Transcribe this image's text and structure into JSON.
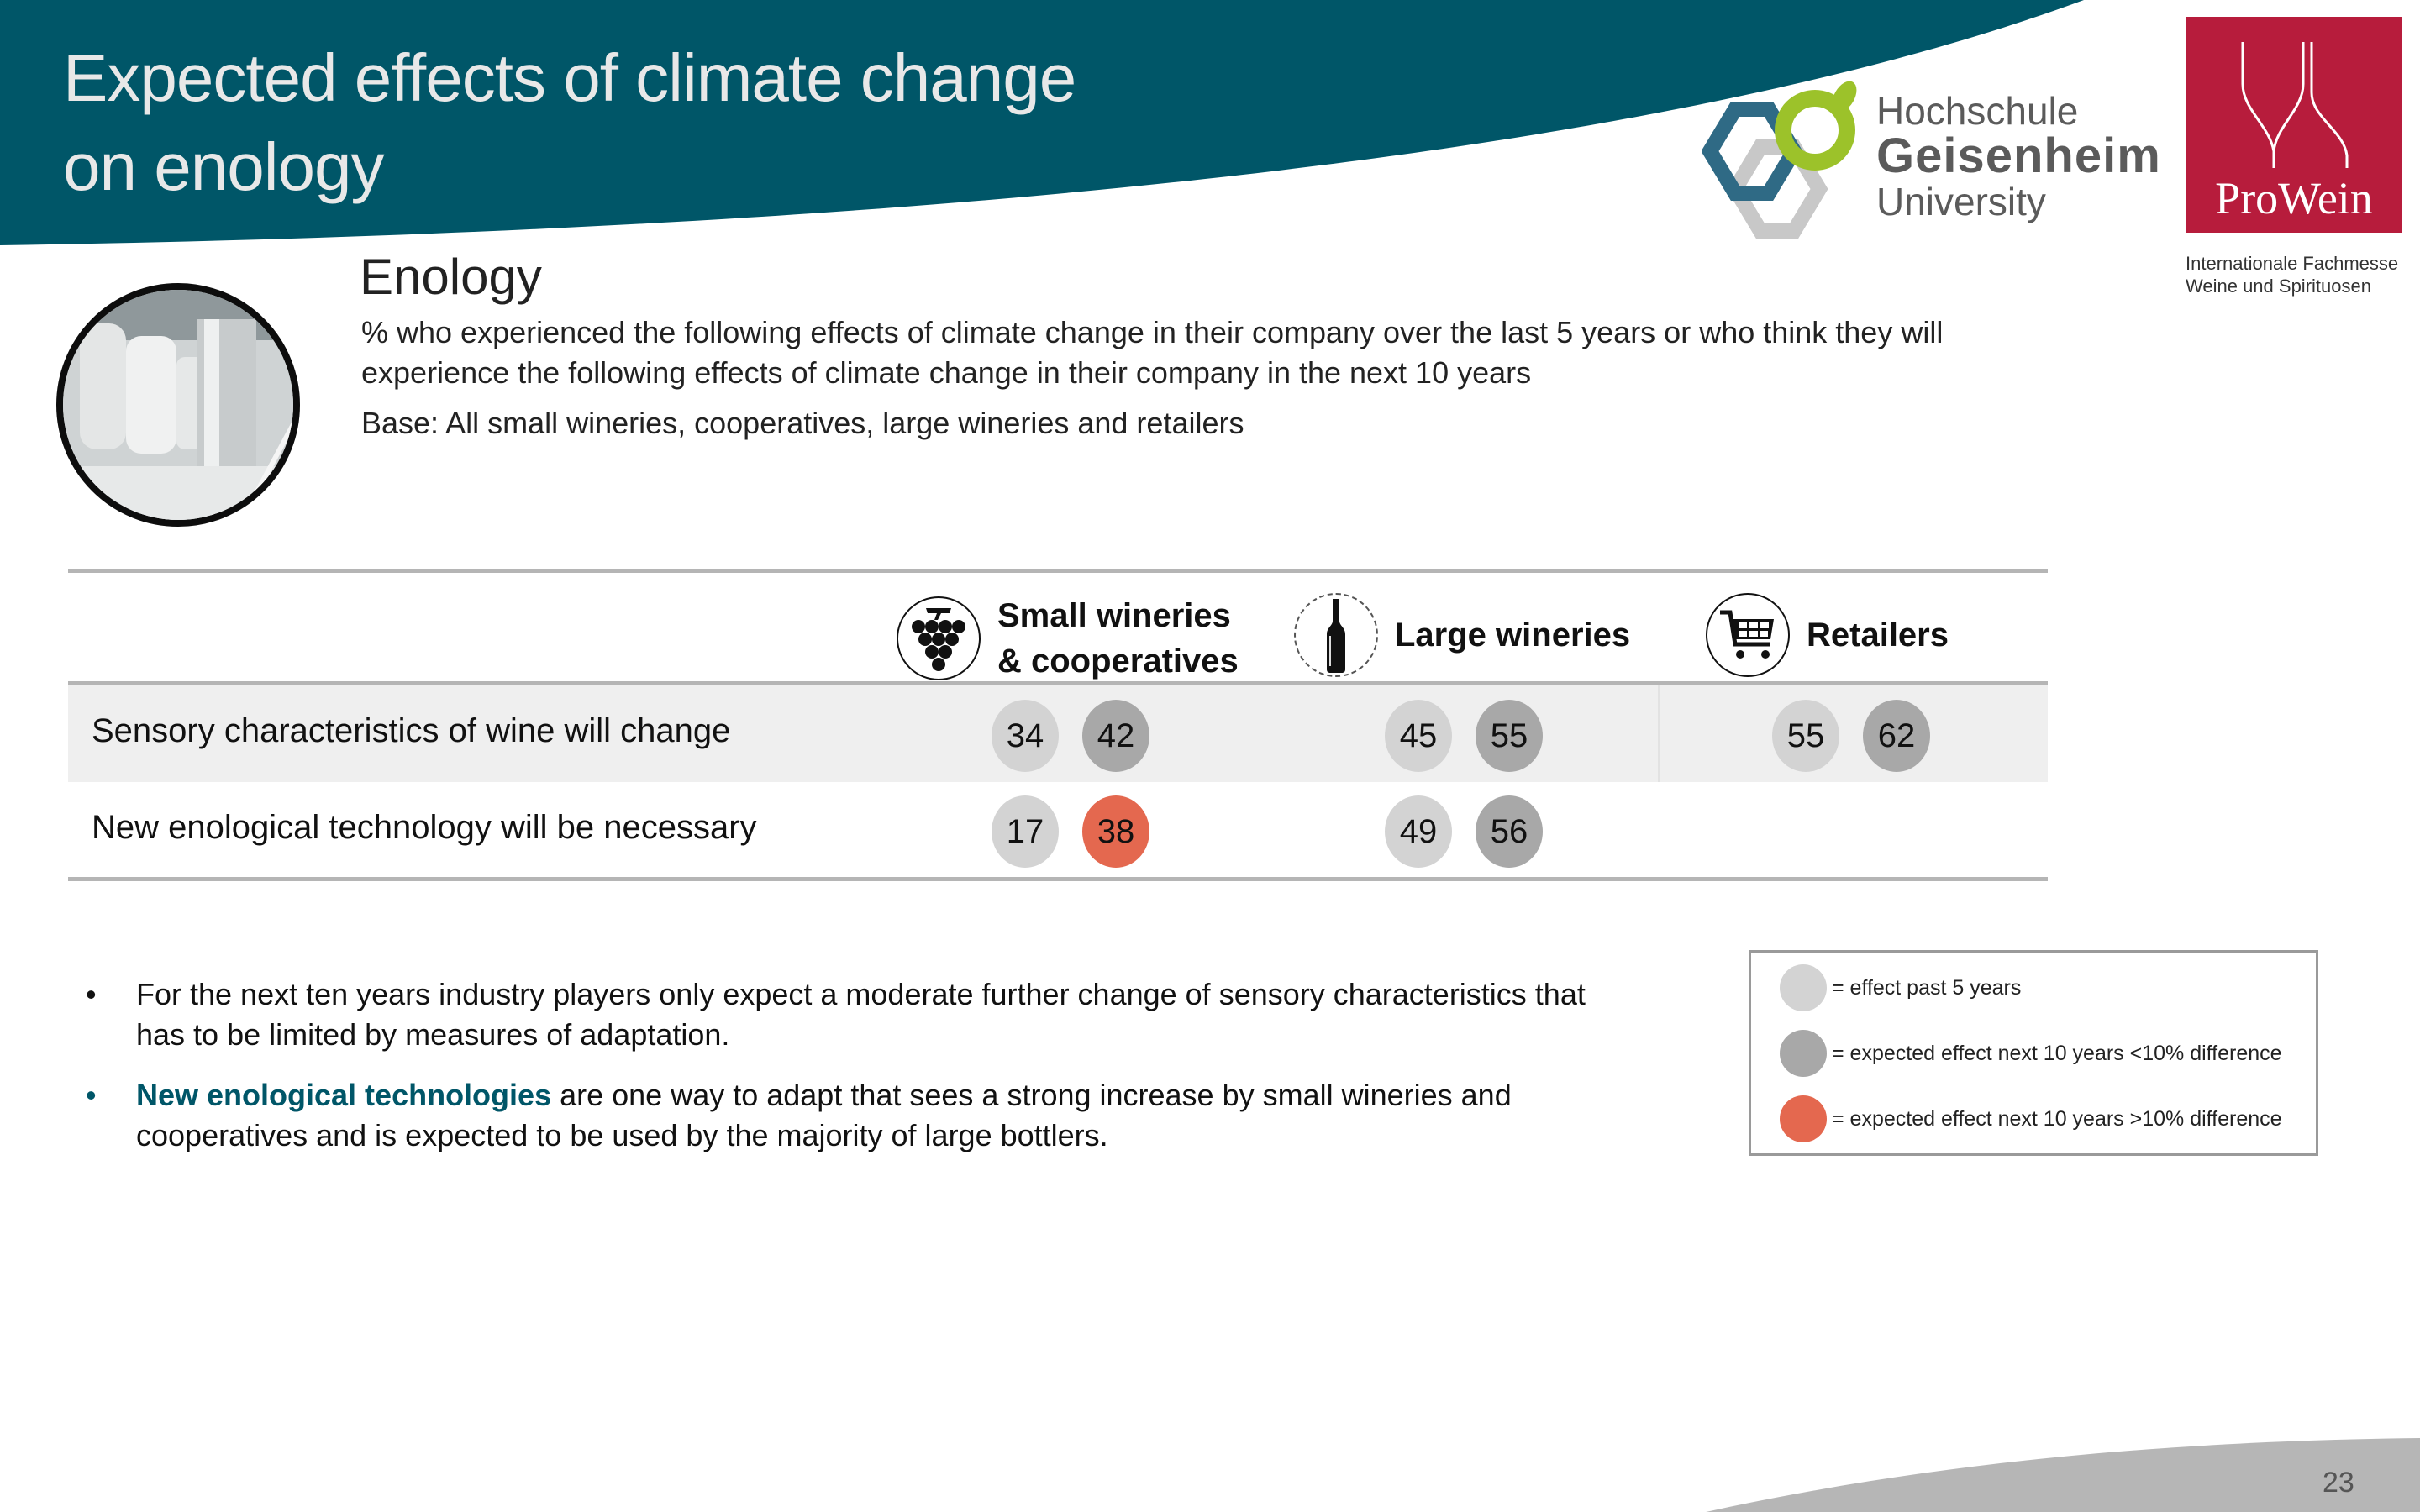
{
  "header": {
    "title_line1": "Expected effects of climate change",
    "title_line2": "on enology",
    "band_color": "#005668"
  },
  "logos": {
    "geisenheim": {
      "line1": "Hochschule",
      "line2": "Geisenheim",
      "line3": "University"
    },
    "prowein": {
      "name": "ProWein",
      "subtitle_line1": "Internationale Fachmesse",
      "subtitle_line2": "Weine und Spirituosen",
      "color": "#b71c3c"
    }
  },
  "section": {
    "heading": "Enology",
    "subtitle": "% who experienced the following effects of climate change in their company over the last 5 years or who think they will experience the following effects of climate change in their company in the next 10 years",
    "base": "Base: All small wineries, cooperatives, large wineries and retailers",
    "photo_icon": "winery-tanks-photo"
  },
  "table": {
    "columns": [
      {
        "label_line1": "Small wineries",
        "label_line2": "& cooperatives",
        "icon": "grapes-icon"
      },
      {
        "label_line1": "Large wineries",
        "label_line2": "",
        "icon": "wine-bottle-icon"
      },
      {
        "label_line1": "Retailers",
        "label_line2": "",
        "icon": "shopping-cart-icon"
      }
    ],
    "rows": [
      {
        "label": "Sensory characteristics of wine will change",
        "cells": [
          {
            "past": "34",
            "expected": "42",
            "expected_type": "lt10"
          },
          {
            "past": "45",
            "expected": "55",
            "expected_type": "lt10"
          },
          {
            "past": "55",
            "expected": "62",
            "expected_type": "lt10"
          }
        ]
      },
      {
        "label": "New enological technology will be necessary",
        "cells": [
          {
            "past": "17",
            "expected": "38",
            "expected_type": "gt10"
          },
          {
            "past": "49",
            "expected": "56",
            "expected_type": "lt10"
          },
          null
        ]
      }
    ]
  },
  "colors": {
    "past": "#d3d3d3",
    "lt10": "#a8a8a8",
    "gt10": "#e4684f",
    "row_shade": "#efefef"
  },
  "bullets": [
    {
      "highlight": "",
      "text": "For the next ten years industry players only expect a moderate further change of sensory characteristics that has to be limited by measures of adaptation."
    },
    {
      "highlight": "New enological technologies",
      "text": " are one way to adapt that sees a strong increase by small wineries and cooperatives and is expected to be used by the majority of large bottlers."
    }
  ],
  "legend": {
    "items": [
      {
        "key": "past",
        "label": "= effect past 5 years"
      },
      {
        "key": "lt10",
        "label": "= expected effect next 10 years <10% difference"
      },
      {
        "key": "gt10",
        "label": "= expected effect next 10 years >10% difference"
      }
    ]
  },
  "footer": {
    "page_number": "23"
  }
}
